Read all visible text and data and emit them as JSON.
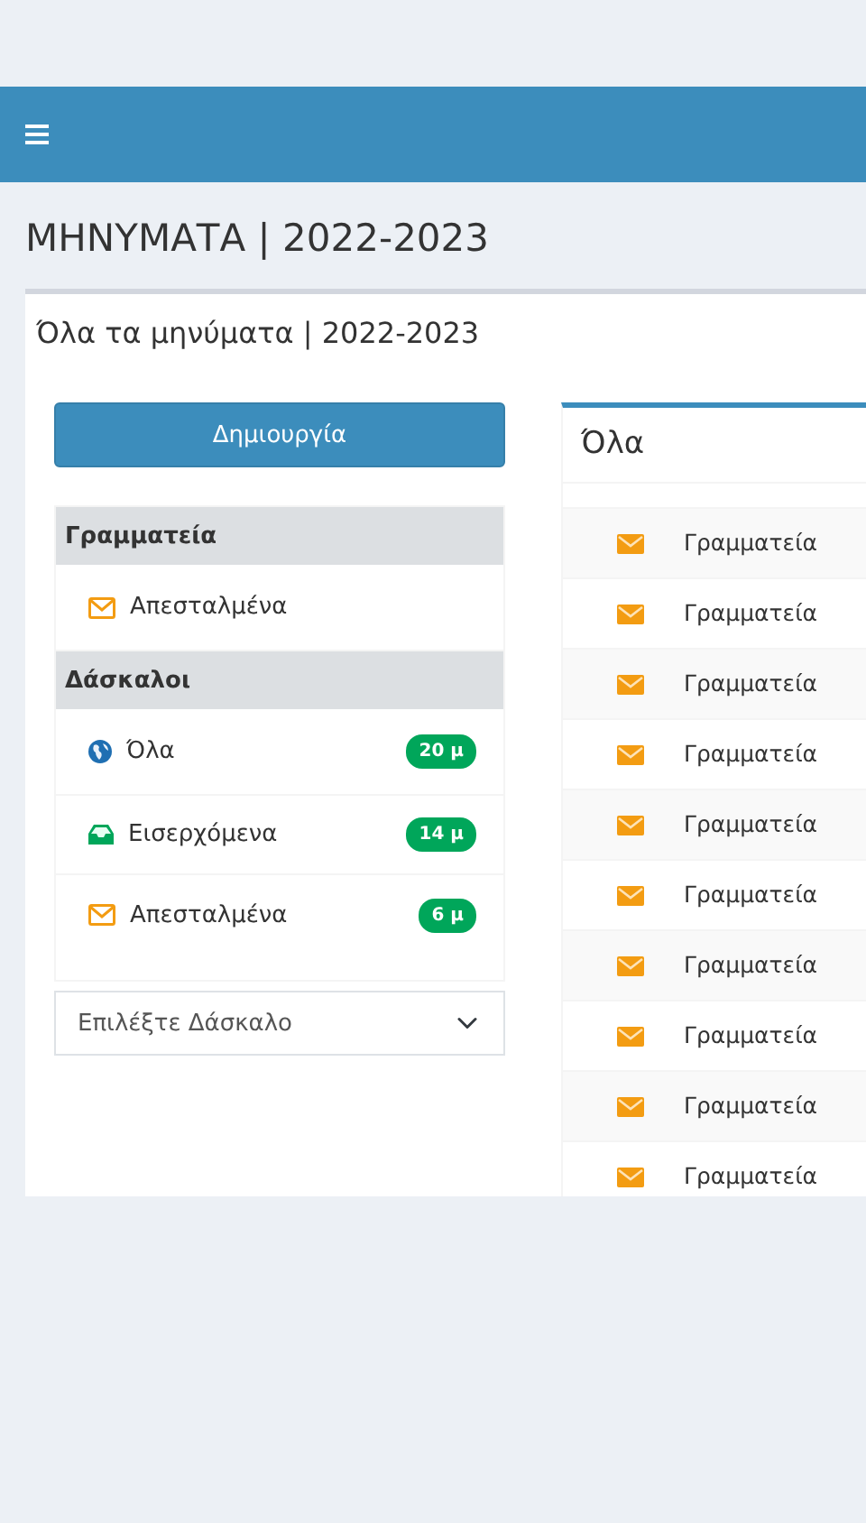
{
  "page_title": "ΜΗΝΥΜΑΤΑ | 2022-2023",
  "card_title": "Όλα τα μηνύματα | 2022-2023",
  "create_button": "Δημιουργία",
  "folder_groups": [
    {
      "title": "Γραμματεία",
      "items": [
        {
          "kind": "sent",
          "label": "Απεσταλμένα"
        }
      ]
    },
    {
      "title": "Δάσκαλοι",
      "items": [
        {
          "kind": "all",
          "label": "Όλα",
          "badge": "20 μ"
        },
        {
          "kind": "inbox",
          "label": "Εισερχόμενα",
          "badge": "14 μ"
        },
        {
          "kind": "sent",
          "label": "Απεσταλμένα",
          "badge": "6 μ"
        }
      ]
    }
  ],
  "teacher_select": {
    "value": "Επιλέξτε Δάσκαλο"
  },
  "messages_panel": {
    "title": "Όλα",
    "rows": [
      {
        "sender": "Γραμματεία"
      },
      {
        "sender": "Γραμματεία"
      },
      {
        "sender": "Γραμματεία"
      },
      {
        "sender": "Γραμματεία"
      },
      {
        "sender": "Γραμματεία"
      },
      {
        "sender": "Γραμματεία"
      },
      {
        "sender": "Γραμματεία"
      },
      {
        "sender": "Γραμματεία"
      },
      {
        "sender": "Γραμματεία"
      },
      {
        "sender": "Γραμματεία"
      }
    ]
  }
}
